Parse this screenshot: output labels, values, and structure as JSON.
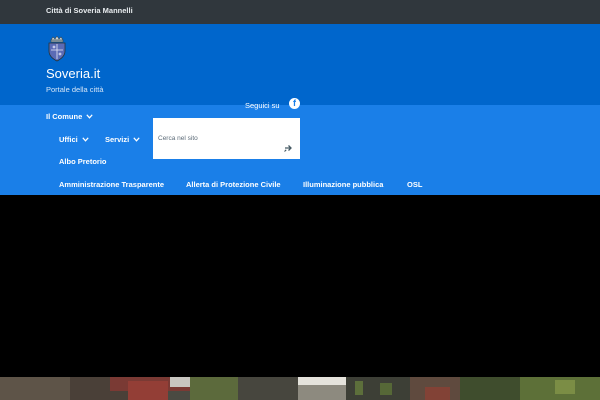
{
  "topbar": {
    "label": "Città di Soveria Mannelli"
  },
  "header": {
    "logo_icon": "coat-of-arms-icon",
    "title": "Soveria.it",
    "subtitle": "Portale della città"
  },
  "social": {
    "label": "Seguici su",
    "icon": "facebook-icon"
  },
  "nav": {
    "il_comune": "Il Comune",
    "uffici": "Uffici",
    "servizi": "Servizi",
    "albo": "Albo Pretorio",
    "amministrazione": "Amministrazione Trasparente",
    "allerta": "Allerta di Protezione Civile",
    "illuminazione": "Illuminazione pubblica",
    "osl": "OSL"
  },
  "search": {
    "placeholder": "Cerca nel sito",
    "icon": "search-arrow-icon"
  },
  "colors": {
    "topbar": "#30373d",
    "header": "#0066cc",
    "navbar": "#1a7fe8",
    "hero": "#000000"
  }
}
